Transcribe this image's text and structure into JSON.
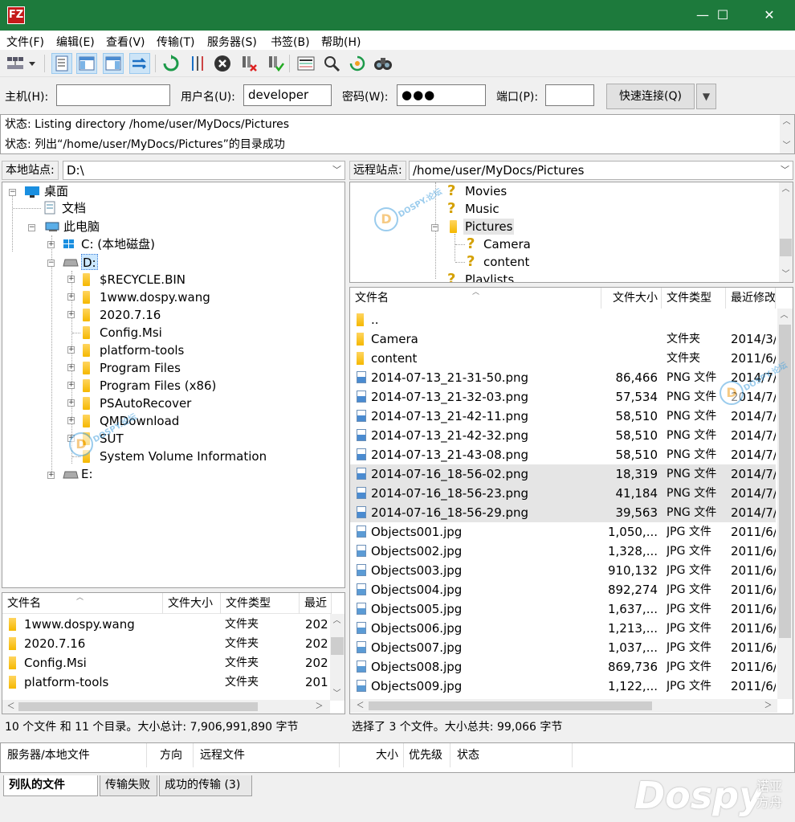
{
  "window": {
    "app_icon": "FZ",
    "minimize": "—",
    "maximize": "☐",
    "close": "✕"
  },
  "menu": [
    "文件(F)",
    "编辑(E)",
    "查看(V)",
    "传输(T)",
    "服务器(S)",
    "书签(B)",
    "帮助(H)"
  ],
  "toolbar": {
    "icons": [
      "site-manager-icon",
      "dropdown-arrow-icon",
      "toggle-message-log-icon",
      "toggle-local-tree-icon",
      "toggle-remote-tree-icon",
      "toggle-transfer-queue-icon",
      "refresh-icon",
      "process-queue-icon",
      "cancel-icon",
      "disconnect-icon",
      "reconnect-icon",
      "directory-comparison-icon",
      "sync-browsing-icon",
      "search-files-icon",
      "filter-icon",
      "find-icon"
    ]
  },
  "quickconnect": {
    "host_label": "主机(H):",
    "host_value": "",
    "user_label": "用户名(U):",
    "user_value": "developer",
    "pass_label": "密码(W):",
    "pass_value": "●●●",
    "port_label": "端口(P):",
    "port_value": "",
    "button": "快速连接(Q)",
    "dropdown": "▼"
  },
  "log": [
    "状态:  Listing directory /home/user/MyDocs/Pictures",
    "状态:  列出“/home/user/MyDocs/Pictures”的目录成功"
  ],
  "local": {
    "path_label": "本地站点:",
    "path": "D:\\",
    "tree": {
      "desktop": "桌面",
      "documents": "文档",
      "this_pc": "此电脑",
      "c_drive": "C: (本地磁盘)",
      "d_drive": "D:",
      "d_children": [
        "$RECYCLE.BIN",
        "1www.dospy.wang",
        "2020.7.16",
        "Config.Msi",
        "platform-tools",
        "Program Files",
        "Program Files (x86)",
        "PSAutoRecover",
        "QMDownload",
        "SUT",
        "System Volume Information"
      ],
      "e_drive": "E:"
    },
    "columns": [
      "文件名",
      "文件大小",
      "文件类型",
      "最近"
    ],
    "files": [
      {
        "name": "1www.dospy.wang",
        "type": "文件夹",
        "date": "202"
      },
      {
        "name": "2020.7.16",
        "type": "文件夹",
        "date": "202"
      },
      {
        "name": "Config.Msi",
        "type": "文件夹",
        "date": "202"
      },
      {
        "name": "platform-tools",
        "type": "文件夹",
        "date": "201"
      }
    ],
    "status": "10 个文件 和 11 个目录。大小总计: 7,906,991,890 字节"
  },
  "remote": {
    "path_label": "远程站点:",
    "path": "/home/user/MyDocs/Pictures",
    "tree": {
      "movies": "Movies",
      "music": "Music",
      "pictures": "Pictures",
      "camera": "Camera",
      "content": "content",
      "playlists": "Playlists"
    },
    "columns": [
      "文件名",
      "文件大小",
      "文件类型",
      "最近修改"
    ],
    "files": [
      {
        "name": "..",
        "size": "",
        "type": "",
        "date": ""
      },
      {
        "name": "Camera",
        "size": "",
        "type": "文件夹",
        "date": "2014/3/"
      },
      {
        "name": "content",
        "size": "",
        "type": "文件夹",
        "date": "2011/6/"
      },
      {
        "name": "2014-07-13_21-31-50.png",
        "size": "86,466",
        "type": "PNG 文件",
        "date": "2014/7/"
      },
      {
        "name": "2014-07-13_21-32-03.png",
        "size": "57,534",
        "type": "PNG 文件",
        "date": "2014/7/"
      },
      {
        "name": "2014-07-13_21-42-11.png",
        "size": "58,510",
        "type": "PNG 文件",
        "date": "2014/7/"
      },
      {
        "name": "2014-07-13_21-42-32.png",
        "size": "58,510",
        "type": "PNG 文件",
        "date": "2014/7/"
      },
      {
        "name": "2014-07-13_21-43-08.png",
        "size": "58,510",
        "type": "PNG 文件",
        "date": "2014/7/"
      },
      {
        "name": "2014-07-16_18-56-02.png",
        "size": "18,319",
        "type": "PNG 文件",
        "date": "2014/7/"
      },
      {
        "name": "2014-07-16_18-56-23.png",
        "size": "41,184",
        "type": "PNG 文件",
        "date": "2014/7/"
      },
      {
        "name": "2014-07-16_18-56-29.png",
        "size": "39,563",
        "type": "PNG 文件",
        "date": "2014/7/"
      },
      {
        "name": "Objects001.jpg",
        "size": "1,050,...",
        "type": "JPG 文件",
        "date": "2011/6/"
      },
      {
        "name": "Objects002.jpg",
        "size": "1,328,...",
        "type": "JPG 文件",
        "date": "2011/6/"
      },
      {
        "name": "Objects003.jpg",
        "size": "910,132",
        "type": "JPG 文件",
        "date": "2011/6/"
      },
      {
        "name": "Objects004.jpg",
        "size": "892,274",
        "type": "JPG 文件",
        "date": "2011/6/"
      },
      {
        "name": "Objects005.jpg",
        "size": "1,637,...",
        "type": "JPG 文件",
        "date": "2011/6/"
      },
      {
        "name": "Objects006.jpg",
        "size": "1,213,...",
        "type": "JPG 文件",
        "date": "2011/6/"
      },
      {
        "name": "Objects007.jpg",
        "size": "1,037,...",
        "type": "JPG 文件",
        "date": "2011/6/"
      },
      {
        "name": "Objects008.jpg",
        "size": "869,736",
        "type": "JPG 文件",
        "date": "2011/6/"
      },
      {
        "name": "Objects009.jpg",
        "size": "1,122,...",
        "type": "JPG 文件",
        "date": "2011/6/"
      }
    ],
    "selected_rows": [
      8,
      9,
      10
    ],
    "status": "选择了 3 个文件。大小总共: 99,066 字节"
  },
  "queue": {
    "columns": [
      "服务器/本地文件",
      "方向",
      "远程文件",
      "大小",
      "优先级",
      "状态"
    ]
  },
  "tabs": [
    "列队的文件",
    "传输失败",
    "成功的传输 (3)"
  ],
  "watermark": {
    "logo_text": "Dospy",
    "logo_sub": "诺亚方舟",
    "small_text": "DOSPY.论坛",
    "circle_letter": "D"
  },
  "colors": {
    "titlebar": "#1d7a3c",
    "selection": "#e5e5e5",
    "folder": "#f5b800"
  }
}
